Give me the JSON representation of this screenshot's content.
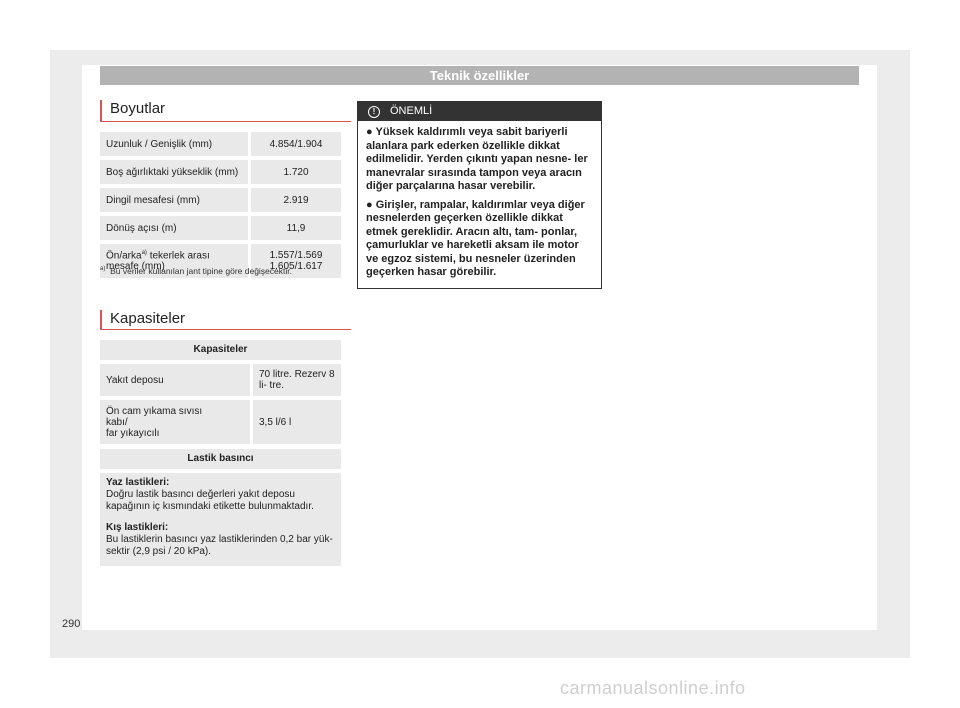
{
  "header": {
    "title": "Teknik özellikler"
  },
  "dimensions": {
    "title": "Boyutlar",
    "rows": [
      {
        "label": "Uzunluk / Genişlik (mm)",
        "value": "4.854/1.904"
      },
      {
        "label": "Boş ağırlıktaki yükseklik (mm)",
        "value": "1.720"
      },
      {
        "label": "Dingil mesafesi (mm)",
        "value": "2.919"
      },
      {
        "label": "Dönüş açısı (m)",
        "value": "11,9"
      },
      {
        "label": "Ön/arka",
        "sup": "a)",
        "label_rest": " tekerlek arası mesafe (mm)",
        "value_line1": "1.557/1.569",
        "value_line2": "1.605/1.617"
      }
    ],
    "footnote_marker": "a)",
    "footnote": "Bu veriler kullanılan jant tipine göre değişecektir."
  },
  "capacities": {
    "title": "Kapasiteler",
    "table_header": "Kapasiteler",
    "fuel_label": "Yakıt deposu",
    "fuel_value": "70 litre. Rezerv 8 li- tre.",
    "washer_label_1": "Ön cam yıkama sıvısı",
    "washer_label_2": "kabı/",
    "washer_label_3": "far yıkayıcılı",
    "washer_value": "3,5 l/6 l",
    "tire_header": "Lastik basıncı",
    "summer_title": "Yaz lastikleri:",
    "summer_text": "Doğru lastik basıncı değerleri yakıt deposu kapağının iç kısmındaki etikette bulunmaktadır.",
    "winter_title": "Kış lastikleri:",
    "winter_text": "Bu lastiklerin basıncı yaz lastiklerinden 0,2 bar yük- sektir (2,9 psi / 20 kPa)."
  },
  "warning": {
    "icon": "warning-circle-icon",
    "title": "ÖNEMLİ",
    "bullet1": "● Yüksek kaldırımlı veya sabit bariyerli alanlara park ederken özellikle dikkat edilmelidir. Yerden çıkıntı yapan nesne- ler manevralar sırasında tampon veya aracın diğer parçalarına hasar verebilir.",
    "bullet2": "● Girişler, rampalar, kaldırımlar veya diğer nesnelerden geçerken özellikle dikkat etmek gereklidir. Aracın altı, tam- ponlar, çamurluklar ve hareketli aksam ile motor ve egzoz sistemi, bu nesneler üzerinden geçerken hasar görebilir."
  },
  "page_number": "290",
  "watermark": "carmanualsonline.info"
}
